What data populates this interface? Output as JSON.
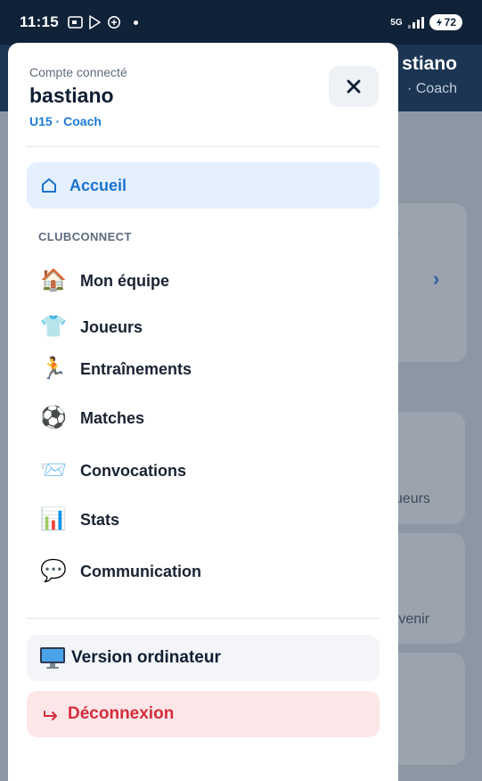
{
  "status_bar": {
    "time": "11:15",
    "network": "5G",
    "battery": "72"
  },
  "background": {
    "user_name_partial": "stiano",
    "role_partial": "· Coach",
    "card_text_1": "oueurs",
    "card_text_2": "à venir"
  },
  "drawer": {
    "caption": "Compte connecté",
    "user_name": "bastiano",
    "role": "U15 · Coach",
    "home_label": "Accueil",
    "section_label": "CLUBCONNECT",
    "items": [
      {
        "label": "Mon équipe",
        "emoji": "🏠"
      },
      {
        "label": "Joueurs",
        "emoji": "👕"
      },
      {
        "label": "Entraînements",
        "emoji": "🏃"
      },
      {
        "label": "Matches",
        "emoji": "⚽"
      },
      {
        "label": "Convocations",
        "emoji": "📨"
      },
      {
        "label": "Stats",
        "emoji": "📊"
      },
      {
        "label": "Communication",
        "emoji": "💬"
      }
    ],
    "desktop_label": "Version ordinateur",
    "logout_label": "Déconnexion"
  }
}
